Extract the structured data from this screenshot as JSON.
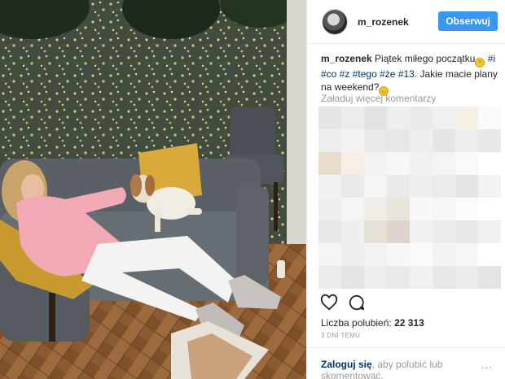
{
  "post": {
    "username": "m_rozenek",
    "follow_label": "Obserwuj",
    "caption": {
      "user": "m_rozenek",
      "text_start": " Piątek miłego początku",
      "emoji_1": "grin-emoji",
      "tags": [
        "#i",
        "#co",
        "#z",
        "#tego",
        "#że",
        "#13"
      ],
      "text_end": ". Jakie macie plany na weekend?",
      "emoji_2": "smile-emoji"
    },
    "load_more_label": "Załaduj więcej komentarzy",
    "likes_label": "Liczba polubień:",
    "likes_count": "22 313",
    "timestamp": "3 DNI TEMU",
    "footer": {
      "login_label": "Zaloguj się",
      "rest_label": ", aby polubić lub skomentować.",
      "more_label": "..."
    }
  },
  "colors": {
    "follow_button": "#3897f0",
    "hashtag": "#003569",
    "muted": "#999999"
  },
  "icons": [
    "heart-icon",
    "comment-icon",
    "more-options-icon"
  ]
}
